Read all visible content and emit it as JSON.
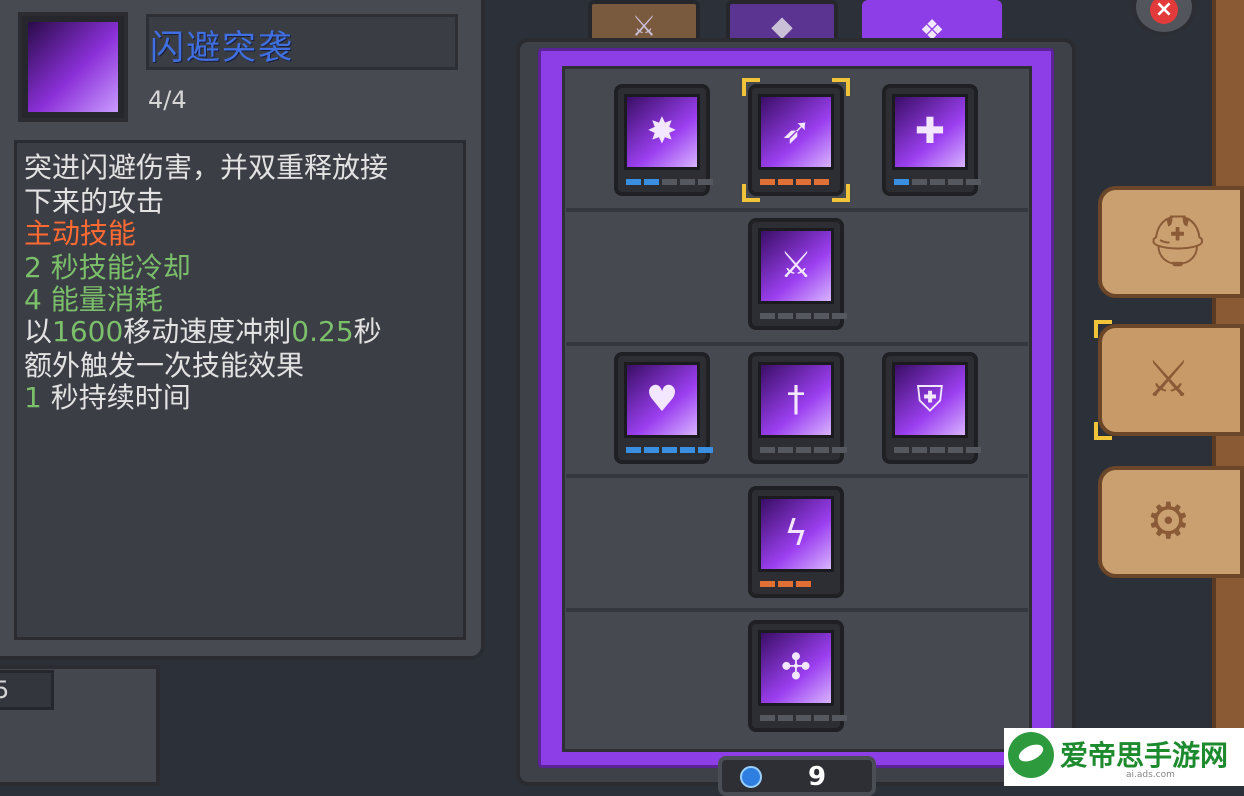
{
  "skill": {
    "name": "闪避突袭",
    "level": "4/4",
    "description_lines": [
      {
        "text": "突进闪避伤害，并双重释放接"
      },
      {
        "text": "下来的攻击"
      },
      {
        "text": "主动技能"
      },
      {
        "num": "2",
        "text": "秒技能冷却"
      },
      {
        "num": "4",
        "text": "能量消耗"
      },
      {
        "pre": "以",
        "speed": "1600",
        "mid": "移动速度冲刺",
        "dur": "0.25",
        "post": "秒"
      },
      {
        "text": "额外触发一次技能效果"
      },
      {
        "num": "1",
        "text": "秒持续时间"
      }
    ],
    "colors": {
      "name": "#3f6fe0",
      "active_tag": "#ff6a33",
      "stat_num": "#7bbf6a"
    }
  },
  "left_counter": "5",
  "tabs": [
    {
      "name": "weapon-tab",
      "icon": "sword-icon",
      "glyph": "⚔"
    },
    {
      "name": "rune-tab",
      "icon": "diamond-icon",
      "glyph": "◆"
    },
    {
      "name": "purple-skill-tab",
      "icon": "crest-icon",
      "glyph": "❖",
      "active": true
    }
  ],
  "tree": {
    "nodes": [
      {
        "id": "burst",
        "icon": "burst-icon",
        "glyph": "✸",
        "pips": [
          "blue",
          "blue",
          "off",
          "off",
          "off"
        ]
      },
      {
        "id": "dash-strike",
        "icon": "dash-icon",
        "glyph": "➶",
        "pips": [
          "orange",
          "orange",
          "orange",
          "orange"
        ],
        "selected": true
      },
      {
        "id": "heal",
        "icon": "heal-plus-icon",
        "glyph": "✚",
        "pips": [
          "blue",
          "off",
          "off",
          "off",
          "off"
        ]
      },
      {
        "id": "twin-blades",
        "icon": "twin-sword-icon",
        "glyph": "⚔",
        "pips": [
          "off",
          "off",
          "off",
          "off",
          "off"
        ]
      },
      {
        "id": "pet",
        "icon": "pet-icon",
        "glyph": "♥",
        "pips": [
          "blue",
          "blue",
          "blue",
          "blue",
          "blue"
        ]
      },
      {
        "id": "sword-aura",
        "icon": "sword-pillar-icon",
        "glyph": "†",
        "pips": [
          "off",
          "off",
          "off",
          "off",
          "off"
        ]
      },
      {
        "id": "shield-up",
        "icon": "shield-up-icon",
        "glyph": "⛨",
        "pips": [
          "off",
          "off",
          "off",
          "off",
          "off"
        ]
      },
      {
        "id": "lightning",
        "icon": "lightning-icon",
        "glyph": "ϟ",
        "pips": [
          "orange",
          "orange",
          "orange"
        ]
      },
      {
        "id": "multi-blade",
        "icon": "multi-blade-icon",
        "glyph": "✣",
        "pips": [
          "off",
          "off",
          "off",
          "off",
          "off"
        ]
      }
    ]
  },
  "side_buttons": [
    {
      "name": "helmet-button",
      "icon": "helmet-icon",
      "glyph": "⛑"
    },
    {
      "name": "skills-button",
      "icon": "sword-arrow-icon",
      "glyph": "⚔",
      "selected": true
    },
    {
      "name": "settings-button",
      "icon": "gear-icon",
      "glyph": "⚙"
    }
  ],
  "bottom_counter": {
    "icon": "gem-icon",
    "value": "9"
  },
  "close_glyph": "×",
  "watermark": {
    "text": "爱帝思手游网",
    "sub": "ai.ads.com"
  }
}
